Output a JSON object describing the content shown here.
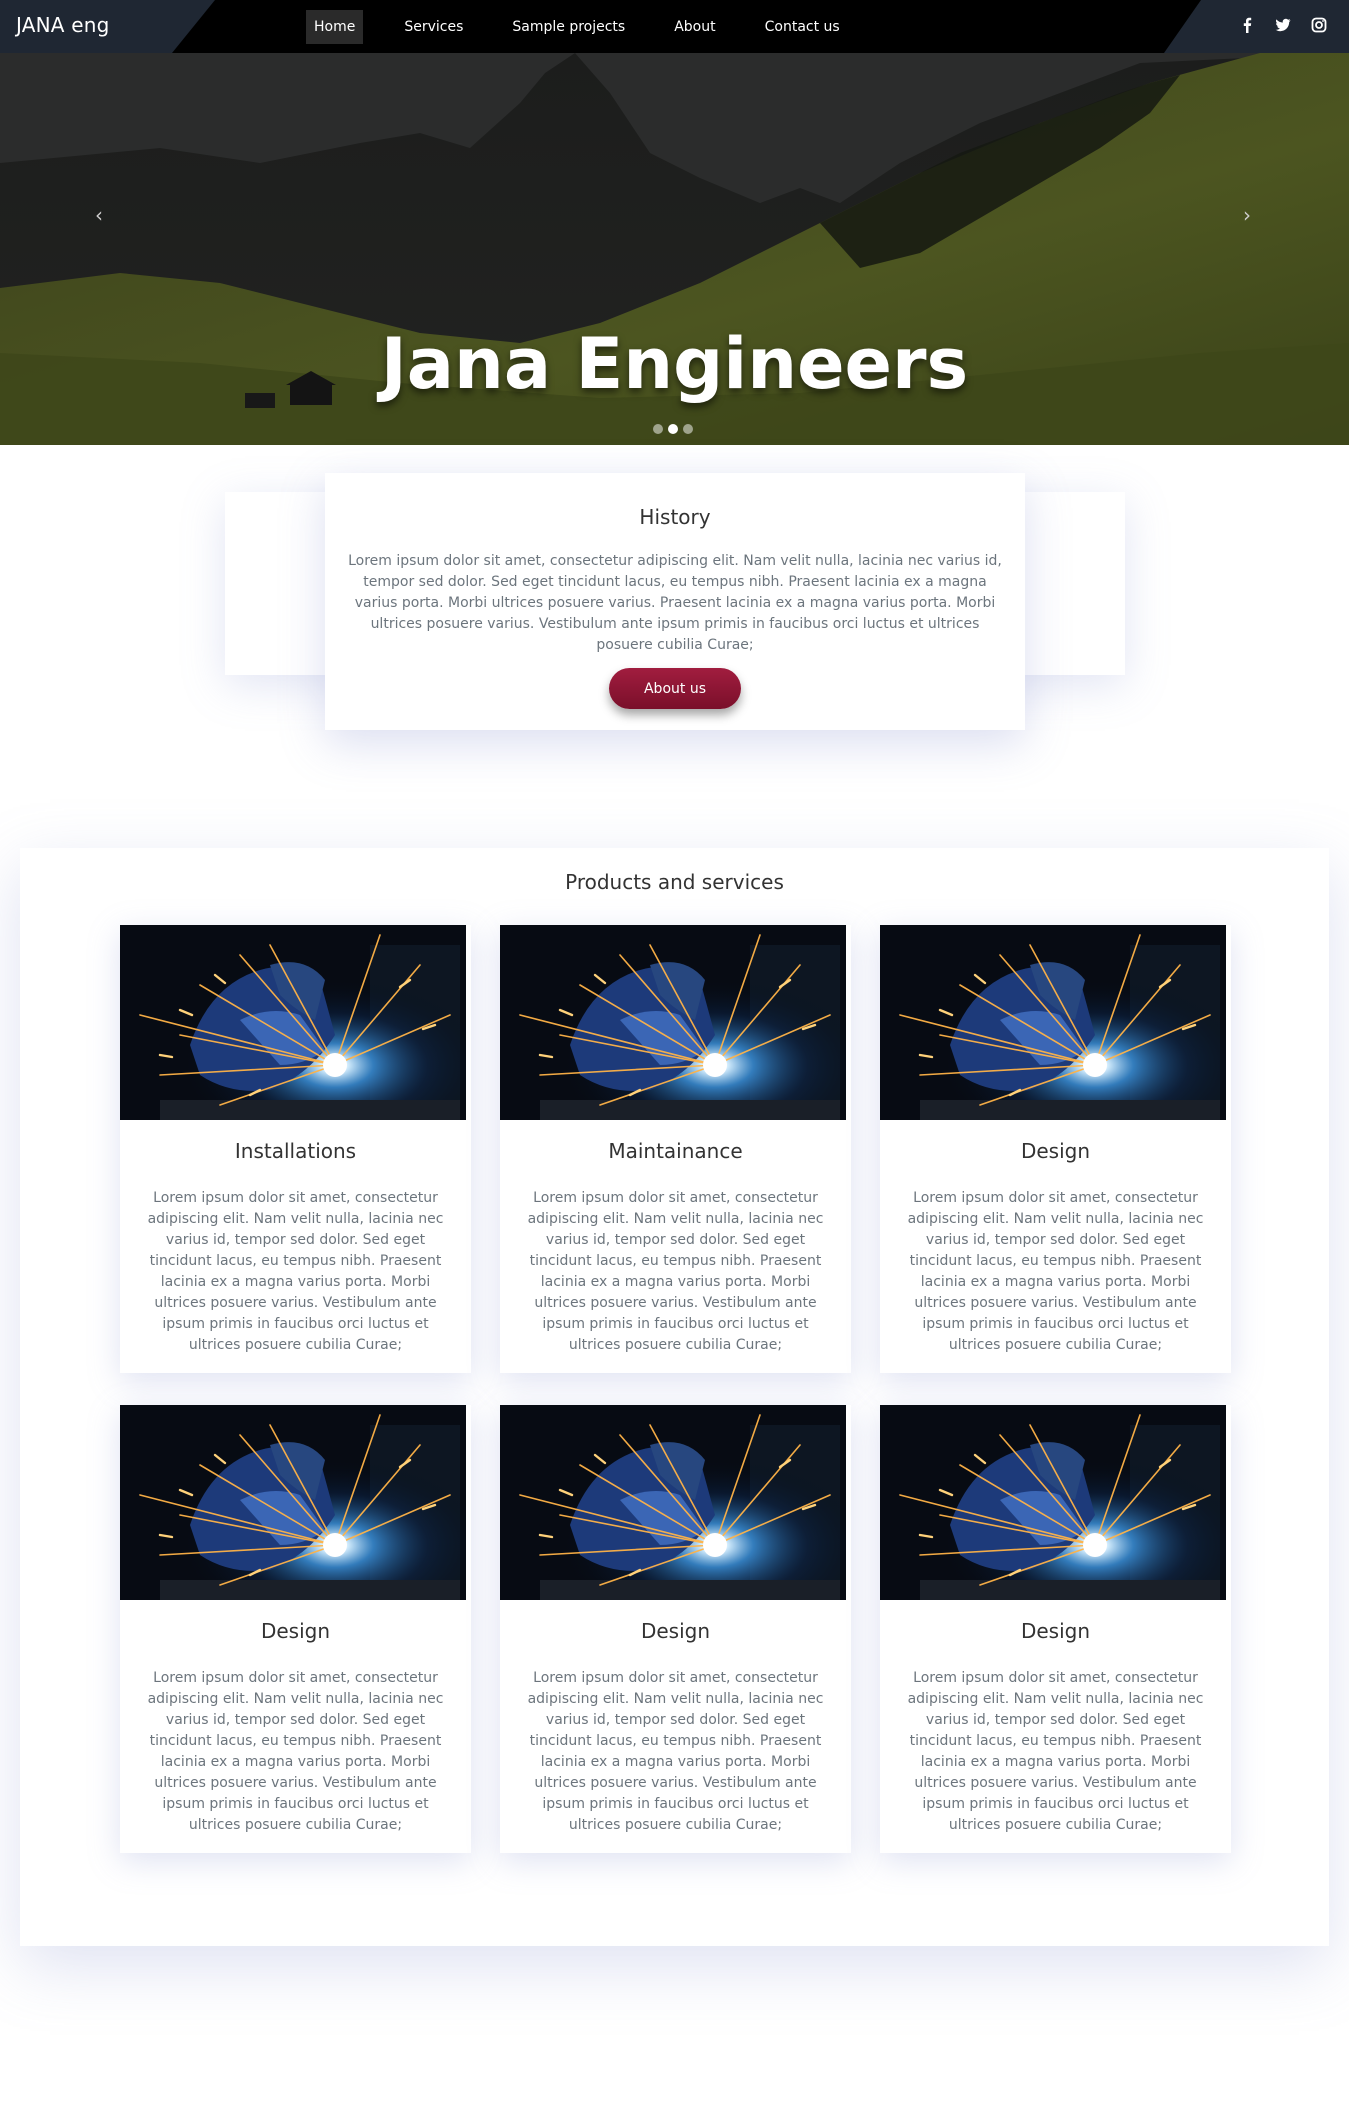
{
  "brand": "JANA eng",
  "nav": {
    "items": [
      "Home",
      "Services",
      "Sample projects",
      "About",
      "Contact us"
    ],
    "active": "Home"
  },
  "social": [
    "facebook-icon",
    "twitter-icon",
    "instagram-icon"
  ],
  "hero": {
    "title": "Jana Engineers",
    "prev_arrow": "‹",
    "next_arrow": "›",
    "slide_count": 3,
    "active_slide": 2
  },
  "history": {
    "title": "History",
    "text": "Lorem ipsum dolor sit amet, consectetur adipiscing elit. Nam velit nulla, lacinia nec varius id, tempor sed dolor. Sed eget tincidunt lacus, eu tempus nibh. Praesent lacinia ex a magna varius porta. Morbi ultrices posuere varius. Praesent lacinia ex a magna varius porta. Morbi ultrices posuere varius. Vestibulum ante ipsum primis in faucibus orci luctus et ultrices posuere cubilia Curae;",
    "button": "About us"
  },
  "products": {
    "title": "Products and services",
    "cards": [
      {
        "title": "Installations",
        "text": "Lorem ipsum dolor sit amet, consectetur adipiscing elit. Nam velit nulla, lacinia nec varius id, tempor sed dolor. Sed eget tincidunt lacus, eu tempus nibh. Praesent lacinia ex a magna varius porta. Morbi ultrices posuere varius. Vestibulum ante ipsum primis in faucibus orci luctus et ultrices posuere cubilia Curae;"
      },
      {
        "title": "Maintainance",
        "text": "Lorem ipsum dolor sit amet, consectetur adipiscing elit. Nam velit nulla, lacinia nec varius id, tempor sed dolor. Sed eget tincidunt lacus, eu tempus nibh. Praesent lacinia ex a magna varius porta. Morbi ultrices posuere varius. Vestibulum ante ipsum primis in faucibus orci luctus et ultrices posuere cubilia Curae;"
      },
      {
        "title": "Design",
        "text": "Lorem ipsum dolor sit amet, consectetur adipiscing elit. Nam velit nulla, lacinia nec varius id, tempor sed dolor. Sed eget tincidunt lacus, eu tempus nibh. Praesent lacinia ex a magna varius porta. Morbi ultrices posuere varius. Vestibulum ante ipsum primis in faucibus orci luctus et ultrices posuere cubilia Curae;"
      },
      {
        "title": "Design",
        "text": "Lorem ipsum dolor sit amet, consectetur adipiscing elit. Nam velit nulla, lacinia nec varius id, tempor sed dolor. Sed eget tincidunt lacus, eu tempus nibh. Praesent lacinia ex a magna varius porta. Morbi ultrices posuere varius. Vestibulum ante ipsum primis in faucibus orci luctus et ultrices posuere cubilia Curae;"
      },
      {
        "title": "Design",
        "text": "Lorem ipsum dolor sit amet, consectetur adipiscing elit. Nam velit nulla, lacinia nec varius id, tempor sed dolor. Sed eget tincidunt lacus, eu tempus nibh. Praesent lacinia ex a magna varius porta. Morbi ultrices posuere varius. Vestibulum ante ipsum primis in faucibus orci luctus et ultrices posuere cubilia Curae;"
      },
      {
        "title": "Design",
        "text": "Lorem ipsum dolor sit amet, consectetur adipiscing elit. Nam velit nulla, lacinia nec varius id, tempor sed dolor. Sed eget tincidunt lacus, eu tempus nibh. Praesent lacinia ex a magna varius porta. Morbi ultrices posuere varius. Vestibulum ante ipsum primis in faucibus orci luctus et ultrices posuere cubilia Curae;"
      }
    ]
  },
  "colors": {
    "navbar": "#000000",
    "nav_wedge": "#1f2733",
    "button": "#8c1535",
    "body_text": "#6c757d"
  }
}
